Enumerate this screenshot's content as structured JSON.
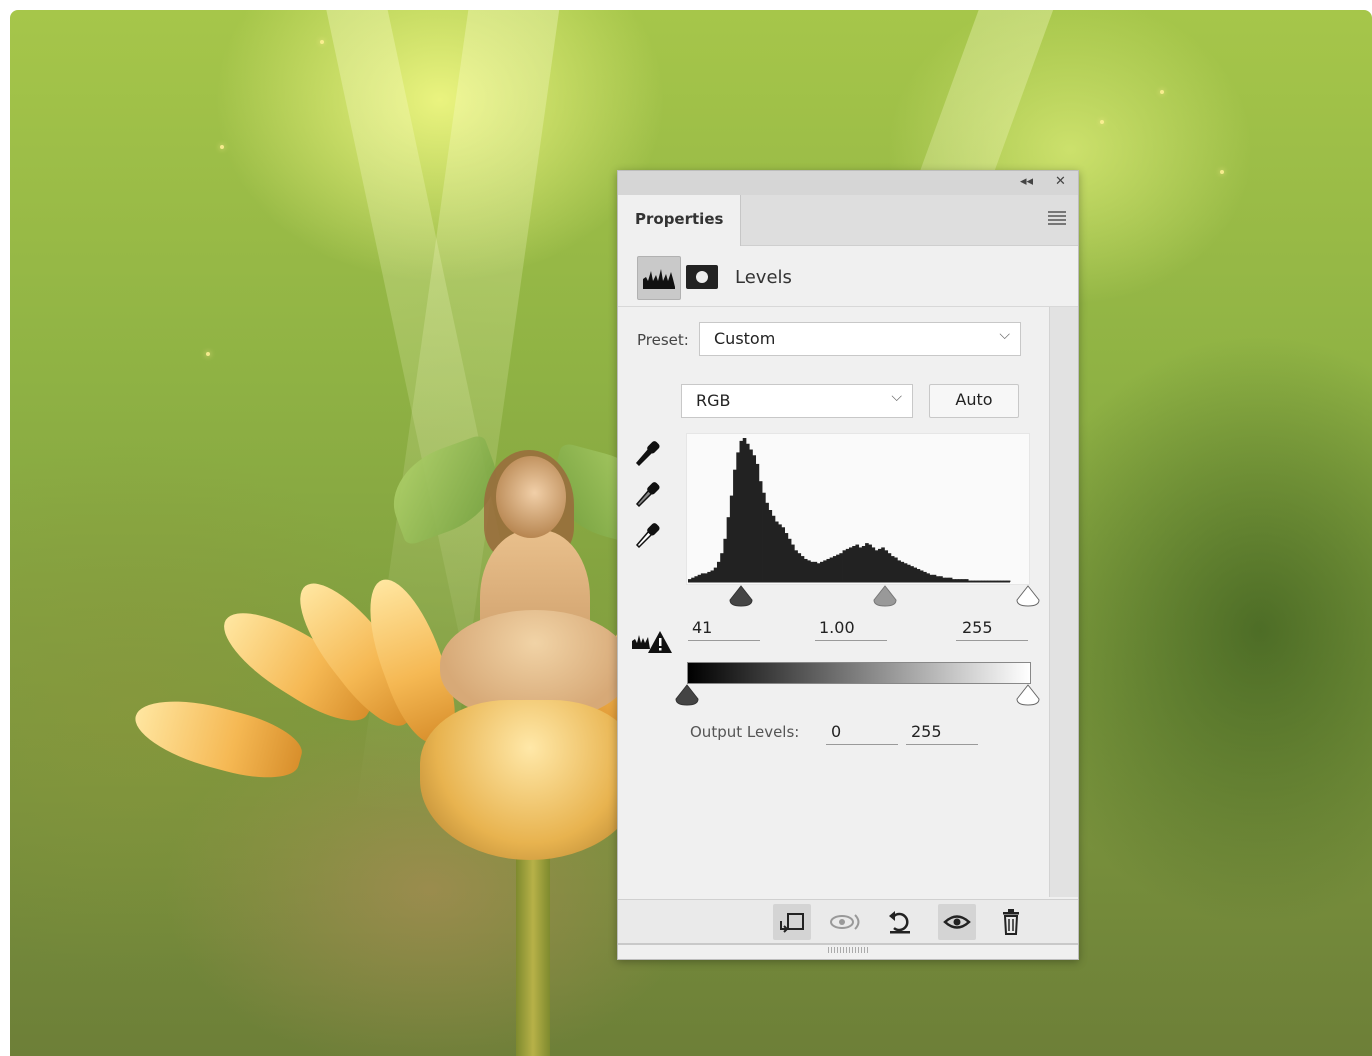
{
  "panel": {
    "collapse_icon": "double-chevron-left",
    "close_icon": "x",
    "tab_label": "Properties",
    "menu_icon": "hamburger-menu",
    "adjustment_title": "Levels",
    "adjustment_icon": "levels-histogram-icon",
    "mask_icon": "layer-mask-icon"
  },
  "preset": {
    "label": "Preset:",
    "value": "Custom"
  },
  "channel": {
    "value": "RGB",
    "auto_label": "Auto"
  },
  "eyedroppers": [
    "black-point-eyedropper",
    "gray-point-eyedropper",
    "white-point-eyedropper"
  ],
  "input_levels": {
    "black": "41",
    "midtone": "1.00",
    "white": "255",
    "warning_icon": "histogram-warning-icon"
  },
  "histogram": {
    "bins": [
      2,
      3,
      4,
      5,
      6,
      6,
      7,
      8,
      10,
      14,
      20,
      30,
      45,
      60,
      78,
      90,
      98,
      100,
      96,
      92,
      88,
      82,
      70,
      62,
      55,
      50,
      46,
      42,
      40,
      38,
      34,
      30,
      26,
      22,
      20,
      18,
      16,
      15,
      14,
      14,
      13,
      14,
      15,
      16,
      17,
      18,
      19,
      20,
      22,
      23,
      24,
      25,
      26,
      24,
      25,
      27,
      26,
      24,
      22,
      23,
      24,
      22,
      20,
      18,
      17,
      15,
      14,
      13,
      12,
      11,
      10,
      9,
      8,
      7,
      6,
      5,
      5,
      4,
      4,
      3,
      3,
      3,
      2,
      2,
      2,
      2,
      2,
      1,
      1,
      1,
      1,
      1,
      1,
      1,
      1,
      1,
      1,
      1,
      1,
      1
    ]
  },
  "output_levels": {
    "label": "Output Levels:",
    "black": "0",
    "white": "255"
  },
  "footer": {
    "clip_icon": "clip-to-layer-icon",
    "view_previous_icon": "view-previous-state-icon",
    "reset_icon": "reset-icon",
    "visibility_icon": "eye-icon",
    "delete_icon": "trash-icon"
  }
}
